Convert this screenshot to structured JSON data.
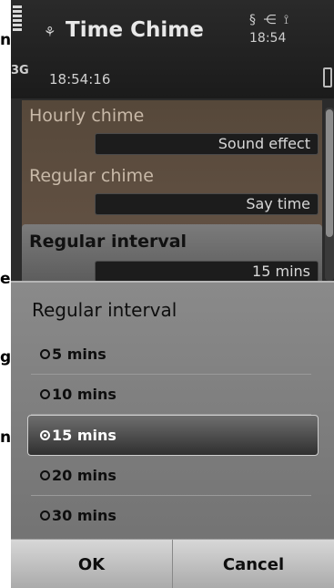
{
  "edge_text": [
    "n",
    "e",
    "g",
    "n"
  ],
  "header": {
    "app_icon": "⚘",
    "title": "Time Chime",
    "status_icons": "§ ⋲ ⟟",
    "clock": "18:54",
    "network": "3G",
    "current_time": "18:54:16"
  },
  "settings": {
    "hourly_label": "Hourly chime",
    "hourly_value": "Sound effect",
    "regular_label": "Regular chime",
    "regular_value": "Say time",
    "interval_label": "Regular interval",
    "interval_value": "15 mins"
  },
  "dialog": {
    "title": "Regular interval",
    "options": [
      "5 mins",
      "10 mins",
      "15 mins",
      "20 mins",
      "30 mins"
    ],
    "selected": "15 mins",
    "ok_label": "OK",
    "cancel_label": "Cancel"
  },
  "colors": {
    "settings_bg": "#5e4e40",
    "dialog_bg": "#7d7d7d"
  }
}
